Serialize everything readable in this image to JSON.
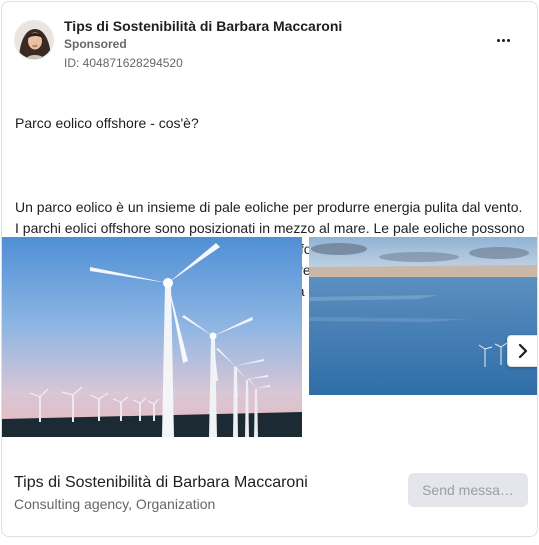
{
  "header": {
    "page_name": "Tips di Sostenibilità di Barbara Maccaroni",
    "sponsored": "Sponsored",
    "ad_id": "ID: 404871628294520"
  },
  "body": {
    "headline": "Parco eolico offshore - cos'è?",
    "text": "Un parco eolico è un insieme di pale eoliche per produrre energia pulita dal vento. I parchi eolici offshore sono posizionati in mezzo al mare. Le pale eoliche possono essere fissate sul fondale del mare o su piattaforme galleggianti. Hanno il vantaggio, rispetto agli impianti a terra (onshore) di sfruttare la forza del vento che in alto mare raggiunge una velocità più elevata e costante rispetto a quella…"
  },
  "carousel": {
    "next_icon": "chevron-right-icon"
  },
  "footer": {
    "title": "Tips di Sostenibilità di Barbara Maccaroni",
    "subtitle": "Consulting agency, Organization",
    "cta_label": "Send messa…"
  },
  "colors": {
    "text_primary": "#1c1e21",
    "text_secondary": "#65676b",
    "cta_bg": "#e4e6eb",
    "border": "#dddfe2"
  }
}
